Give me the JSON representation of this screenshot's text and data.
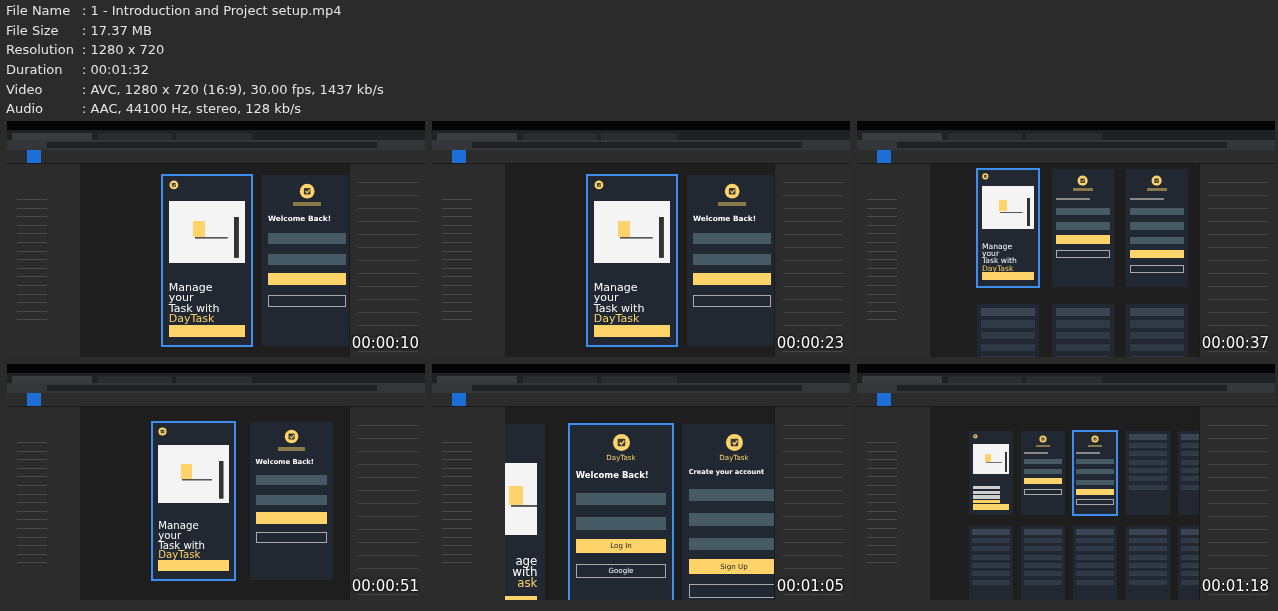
{
  "file_info": [
    {
      "label": "File Name",
      "value": ": 1 - Introduction and Project setup.mp4"
    },
    {
      "label": "File Size",
      "value": ": 17.37 MB"
    },
    {
      "label": "Resolution",
      "value": ": 1280 x 720"
    },
    {
      "label": "Duration",
      "value": ": 00:01:32"
    },
    {
      "label": "Video",
      "value": ": AVC, 1280 x 720 (16:9), 30.00 fps, 1437 kb/s"
    },
    {
      "label": "Audio",
      "value": ": AAC, 44100 Hz, stereo, 128 kb/s"
    }
  ],
  "thumbnails": [
    {
      "timestamp": "00:00:10",
      "frames": [
        {
          "kind": "splash",
          "selected": true,
          "lines": [
            "Manage",
            "your",
            "Task with"
          ],
          "accent": "DayTask"
        },
        {
          "kind": "signin",
          "selected": false,
          "heading": "Welcome Back!"
        }
      ]
    },
    {
      "timestamp": "00:00:23",
      "frames": [
        {
          "kind": "splash",
          "selected": true,
          "lines": [
            "Manage",
            "your",
            "Task with"
          ],
          "accent": "DayTask"
        },
        {
          "kind": "signin",
          "selected": false,
          "heading": "Welcome Back!"
        }
      ]
    },
    {
      "timestamp": "00:00:37",
      "frames": [
        {
          "kind": "splash",
          "selected": true,
          "lines": [
            "Manage",
            "your",
            "Task with"
          ],
          "accent": "DayTask"
        },
        {
          "kind": "signin",
          "selected": false
        },
        {
          "kind": "signup",
          "selected": false
        },
        {
          "kind": "other",
          "selected": false
        },
        {
          "kind": "other",
          "selected": false
        },
        {
          "kind": "other",
          "selected": false
        }
      ]
    },
    {
      "timestamp": "00:00:51",
      "frames": [
        {
          "kind": "splash",
          "selected": true,
          "lines": [
            "Manage",
            "your",
            "Task with"
          ],
          "accent": "DayTask"
        },
        {
          "kind": "signin",
          "selected": false,
          "heading": "Welcome Back!"
        }
      ]
    },
    {
      "timestamp": "00:01:05",
      "frames": [
        {
          "kind": "splash-partial",
          "selected": false,
          "lines": [
            "age",
            "with"
          ],
          "accent": "ask"
        },
        {
          "kind": "signin",
          "selected": true,
          "brand": "DayTask",
          "heading": "Welcome Back!",
          "button": "Log In",
          "alt_button": "Google"
        },
        {
          "kind": "signup",
          "selected": false,
          "brand": "DayTask",
          "heading": "Create your account",
          "button": "Sign Up"
        }
      ]
    },
    {
      "timestamp": "00:01:18",
      "frames": [
        {
          "kind": "splash",
          "selected": false
        },
        {
          "kind": "signin",
          "selected": false
        },
        {
          "kind": "signup",
          "selected": true
        },
        {
          "kind": "other",
          "selected": false
        },
        {
          "kind": "other",
          "selected": false
        },
        {
          "kind": "other",
          "selected": false
        },
        {
          "kind": "other",
          "selected": false
        },
        {
          "kind": "other",
          "selected": false
        },
        {
          "kind": "other",
          "selected": false
        },
        {
          "kind": "other",
          "selected": false
        }
      ]
    }
  ]
}
